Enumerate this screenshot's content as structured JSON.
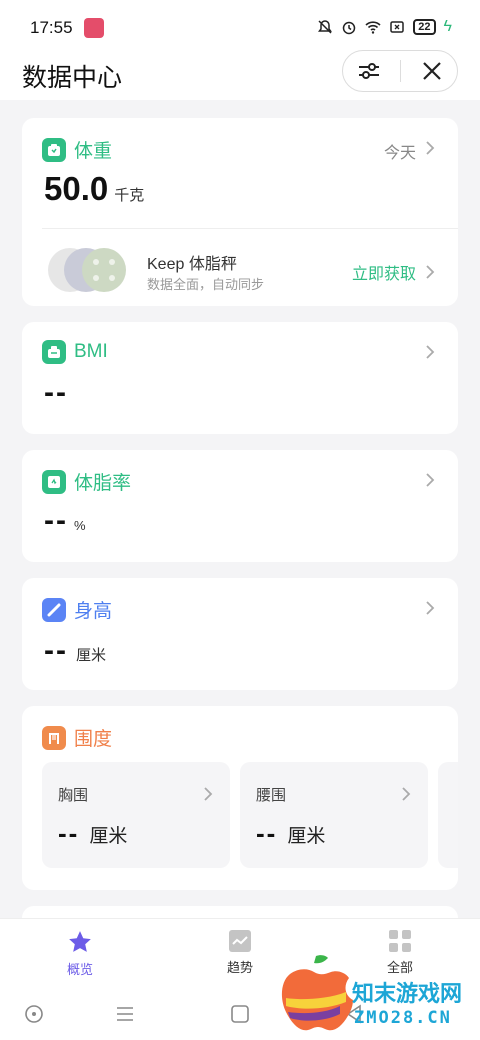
{
  "status_bar": {
    "time": "17:55",
    "battery": "22"
  },
  "header": {
    "title": "数据中心"
  },
  "weight": {
    "title": "体重",
    "date": "今天",
    "value": "50.0",
    "unit": "千克"
  },
  "keep_scale": {
    "name": "Keep 体脂秤",
    "desc": "数据全面，自动同步",
    "action": "立即获取"
  },
  "bmi": {
    "title": "BMI",
    "value": "--"
  },
  "body_fat": {
    "title": "体脂率",
    "value": "--",
    "unit": "%"
  },
  "height": {
    "title": "身高",
    "value": "--",
    "unit": "厘米"
  },
  "girth": {
    "title": "围度",
    "items": [
      {
        "label": "胸围",
        "value": "--",
        "unit": "厘米"
      },
      {
        "label": "腰围",
        "value": "--",
        "unit": "厘米"
      }
    ]
  },
  "tabs": [
    {
      "label": "概览",
      "active": true
    },
    {
      "label": "趋势",
      "active": false
    },
    {
      "label": "全部",
      "active": false
    }
  ],
  "watermark": {
    "line1": "知末游戏网",
    "line2": "ZMO28.CN"
  },
  "colors": {
    "green": "#2fbd84",
    "blue": "#5b84f5",
    "orange": "#f08b4c",
    "purple": "#6c5ce7"
  }
}
